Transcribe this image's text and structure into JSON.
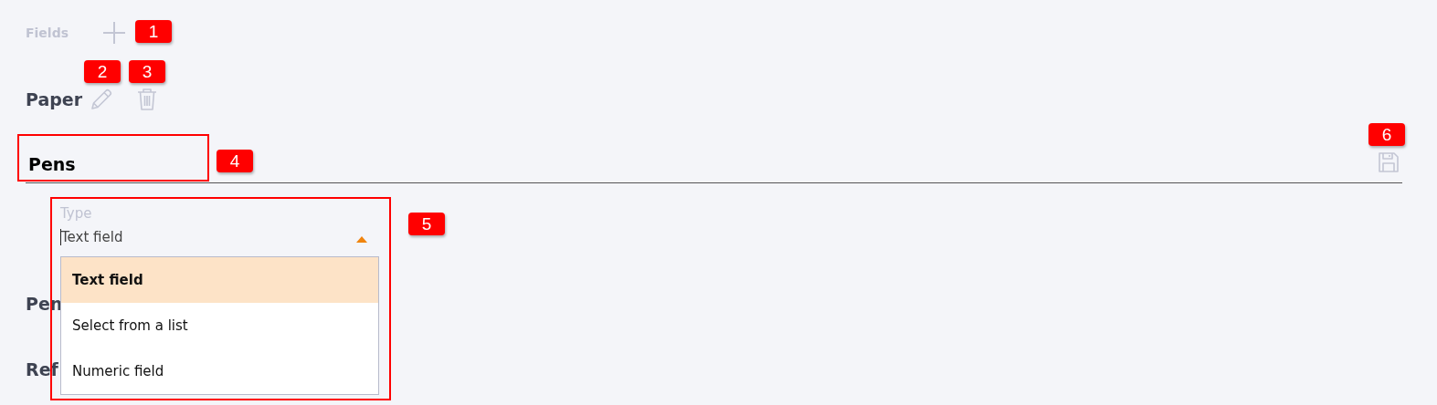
{
  "header": {
    "title": "Fields"
  },
  "current": {
    "name": "Paper"
  },
  "editor": {
    "name": "Pens",
    "type_field": {
      "label": "Type",
      "value": "Text field",
      "expanded": true,
      "options": [
        {
          "label": "Text field",
          "selected": true
        },
        {
          "label": "Select from a list",
          "selected": false
        },
        {
          "label": "Numeric field",
          "selected": false
        }
      ]
    }
  },
  "items": [
    {
      "name": "Pen"
    },
    {
      "name": "Ref"
    }
  ],
  "annotations": [
    {
      "label": "1"
    },
    {
      "label": "2"
    },
    {
      "label": "3"
    },
    {
      "label": "4"
    },
    {
      "label": "5"
    },
    {
      "label": "6"
    }
  ]
}
